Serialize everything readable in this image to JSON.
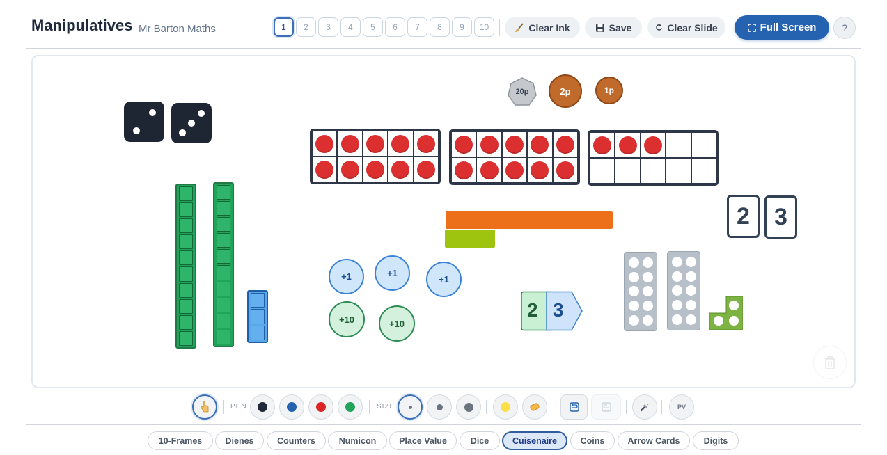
{
  "header": {
    "title": "Manipulatives",
    "subtitle": "Mr Barton Maths",
    "slides": [
      "1",
      "2",
      "3",
      "4",
      "5",
      "6",
      "7",
      "8",
      "9",
      "10"
    ],
    "active_slide": "1",
    "clear_ink_label": "Clear Ink",
    "save_label": "Save",
    "clear_slide_label": "Clear Slide",
    "full_screen_label": "Full Screen",
    "help_label": "?"
  },
  "canvas": {
    "coins": [
      "20p",
      "2p",
      "1p"
    ],
    "counters_one": [
      "+1",
      "+1",
      "+1"
    ],
    "counters_ten": [
      "+10",
      "+10"
    ],
    "digit_cards": [
      "2",
      "3"
    ],
    "arrow_card": {
      "tens": "2",
      "ones": "3"
    },
    "ten_frames_filled": [
      10,
      10,
      3
    ]
  },
  "toolbar": {
    "pen_label": "PEN",
    "size_label": "SIZE",
    "pv_label": "PV",
    "pen_colors": [
      "#1f2937",
      "#2563b0",
      "#dc2626",
      "#22a35a"
    ]
  },
  "tabs": [
    "10-Frames",
    "Dienes",
    "Counters",
    "Numicon",
    "Place Value",
    "Dice",
    "Cuisenaire",
    "Coins",
    "Arrow Cards",
    "Digits"
  ],
  "active_tab": "Cuisenaire",
  "colors": {
    "accent": "#2563b0",
    "counter_red": "#dc3030",
    "dienes_green": "#22a35a",
    "cuisenaire_orange": "#ec6f1a",
    "cuisenaire_lime": "#9ec40f"
  }
}
